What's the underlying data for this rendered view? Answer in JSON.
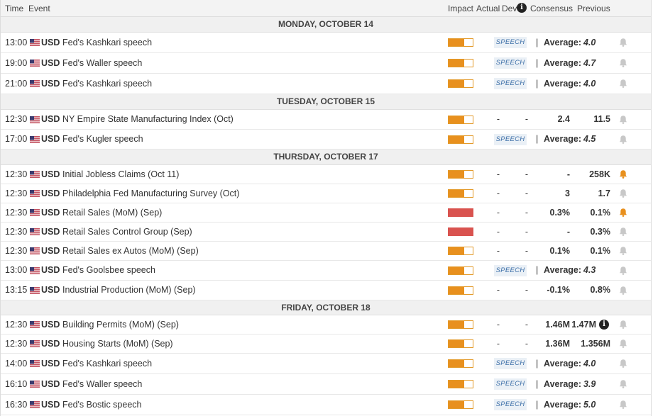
{
  "header": {
    "time": "Time",
    "event": "Event",
    "impact": "Impact",
    "actual": "Actual",
    "dev": "Dev",
    "info_icon": "i",
    "consensus": "Consensus",
    "previous": "Previous"
  },
  "labels": {
    "speech": "SPEECH",
    "separator": "|",
    "average": "Average:",
    "dash": "-",
    "info": "i"
  },
  "colors": {
    "impact_medium": "#e8901e",
    "impact_high": "#d9534f",
    "bell_active": "#e8901e",
    "bell_inactive": "#c8c8c8",
    "speech_text": "#3d6fa8"
  },
  "days": [
    {
      "label": "MONDAY, OCTOBER 14",
      "events": [
        {
          "time": "13:00",
          "currency": "USD",
          "name": "Fed's Kashkari speech",
          "impact": "medium",
          "impact_fill": 0.66,
          "type": "speech",
          "average": "4.0",
          "bell": "off"
        },
        {
          "time": "19:00",
          "currency": "USD",
          "name": "Fed's Waller speech",
          "impact": "medium",
          "impact_fill": 0.66,
          "type": "speech",
          "average": "4.7",
          "bell": "off"
        },
        {
          "time": "21:00",
          "currency": "USD",
          "name": "Fed's Kashkari speech",
          "impact": "medium",
          "impact_fill": 0.66,
          "type": "speech",
          "average": "4.0",
          "bell": "off"
        }
      ]
    },
    {
      "label": "TUESDAY, OCTOBER 15",
      "events": [
        {
          "time": "12:30",
          "currency": "USD",
          "name": "NY Empire State Manufacturing Index (Oct)",
          "impact": "medium",
          "impact_fill": 0.66,
          "type": "data",
          "actual": "-",
          "dev": "-",
          "consensus": "2.4",
          "previous": "11.5",
          "bell": "off"
        },
        {
          "time": "17:00",
          "currency": "USD",
          "name": "Fed's Kugler speech",
          "impact": "medium",
          "impact_fill": 0.66,
          "type": "speech",
          "average": "4.5",
          "bell": "off"
        }
      ]
    },
    {
      "label": "THURSDAY, OCTOBER 17",
      "events": [
        {
          "time": "12:30",
          "currency": "USD",
          "name": "Initial Jobless Claims (Oct 11)",
          "impact": "medium",
          "impact_fill": 0.66,
          "type": "data",
          "actual": "-",
          "dev": "-",
          "consensus": "-",
          "previous": "258K",
          "bell": "on"
        },
        {
          "time": "12:30",
          "currency": "USD",
          "name": "Philadelphia Fed Manufacturing Survey (Oct)",
          "impact": "medium",
          "impact_fill": 0.66,
          "type": "data",
          "actual": "-",
          "dev": "-",
          "consensus": "3",
          "previous": "1.7",
          "bell": "off"
        },
        {
          "time": "12:30",
          "currency": "USD",
          "name": "Retail Sales (MoM) (Sep)",
          "impact": "high",
          "impact_fill": 1.0,
          "type": "data",
          "actual": "-",
          "dev": "-",
          "consensus": "0.3%",
          "previous": "0.1%",
          "bell": "on"
        },
        {
          "time": "12:30",
          "currency": "USD",
          "name": "Retail Sales Control Group (Sep)",
          "impact": "high",
          "impact_fill": 1.0,
          "type": "data",
          "actual": "-",
          "dev": "-",
          "consensus": "-",
          "previous": "0.3%",
          "bell": "off"
        },
        {
          "time": "12:30",
          "currency": "USD",
          "name": "Retail Sales ex Autos (MoM) (Sep)",
          "impact": "medium",
          "impact_fill": 0.66,
          "type": "data",
          "actual": "-",
          "dev": "-",
          "consensus": "0.1%",
          "previous": "0.1%",
          "bell": "off"
        },
        {
          "time": "13:00",
          "currency": "USD",
          "name": "Fed's Goolsbee speech",
          "impact": "medium",
          "impact_fill": 0.66,
          "type": "speech",
          "average": "4.3",
          "bell": "off"
        },
        {
          "time": "13:15",
          "currency": "USD",
          "name": "Industrial Production (MoM) (Sep)",
          "impact": "medium",
          "impact_fill": 0.66,
          "type": "data",
          "actual": "-",
          "dev": "-",
          "consensus": "-0.1%",
          "previous": "0.8%",
          "bell": "off"
        }
      ]
    },
    {
      "label": "FRIDAY, OCTOBER 18",
      "events": [
        {
          "time": "12:30",
          "currency": "USD",
          "name": "Building Permits (MoM) (Sep)",
          "impact": "medium",
          "impact_fill": 0.66,
          "type": "data",
          "actual": "-",
          "dev": "-",
          "consensus": "1.46M",
          "previous": "1.47M",
          "previous_info": true,
          "bell": "off"
        },
        {
          "time": "12:30",
          "currency": "USD",
          "name": "Housing Starts (MoM) (Sep)",
          "impact": "medium",
          "impact_fill": 0.66,
          "type": "data",
          "actual": "-",
          "dev": "-",
          "consensus": "1.36M",
          "previous": "1.356M",
          "bell": "off"
        },
        {
          "time": "14:00",
          "currency": "USD",
          "name": "Fed's Kashkari speech",
          "impact": "medium",
          "impact_fill": 0.66,
          "type": "speech",
          "average": "4.0",
          "bell": "off"
        },
        {
          "time": "16:10",
          "currency": "USD",
          "name": "Fed's Waller speech",
          "impact": "medium",
          "impact_fill": 0.66,
          "type": "speech",
          "average": "3.9",
          "bell": "off"
        },
        {
          "time": "16:30",
          "currency": "USD",
          "name": "Fed's Bostic speech",
          "impact": "medium",
          "impact_fill": 0.66,
          "type": "speech",
          "average": "5.0",
          "bell": "off"
        }
      ]
    }
  ]
}
